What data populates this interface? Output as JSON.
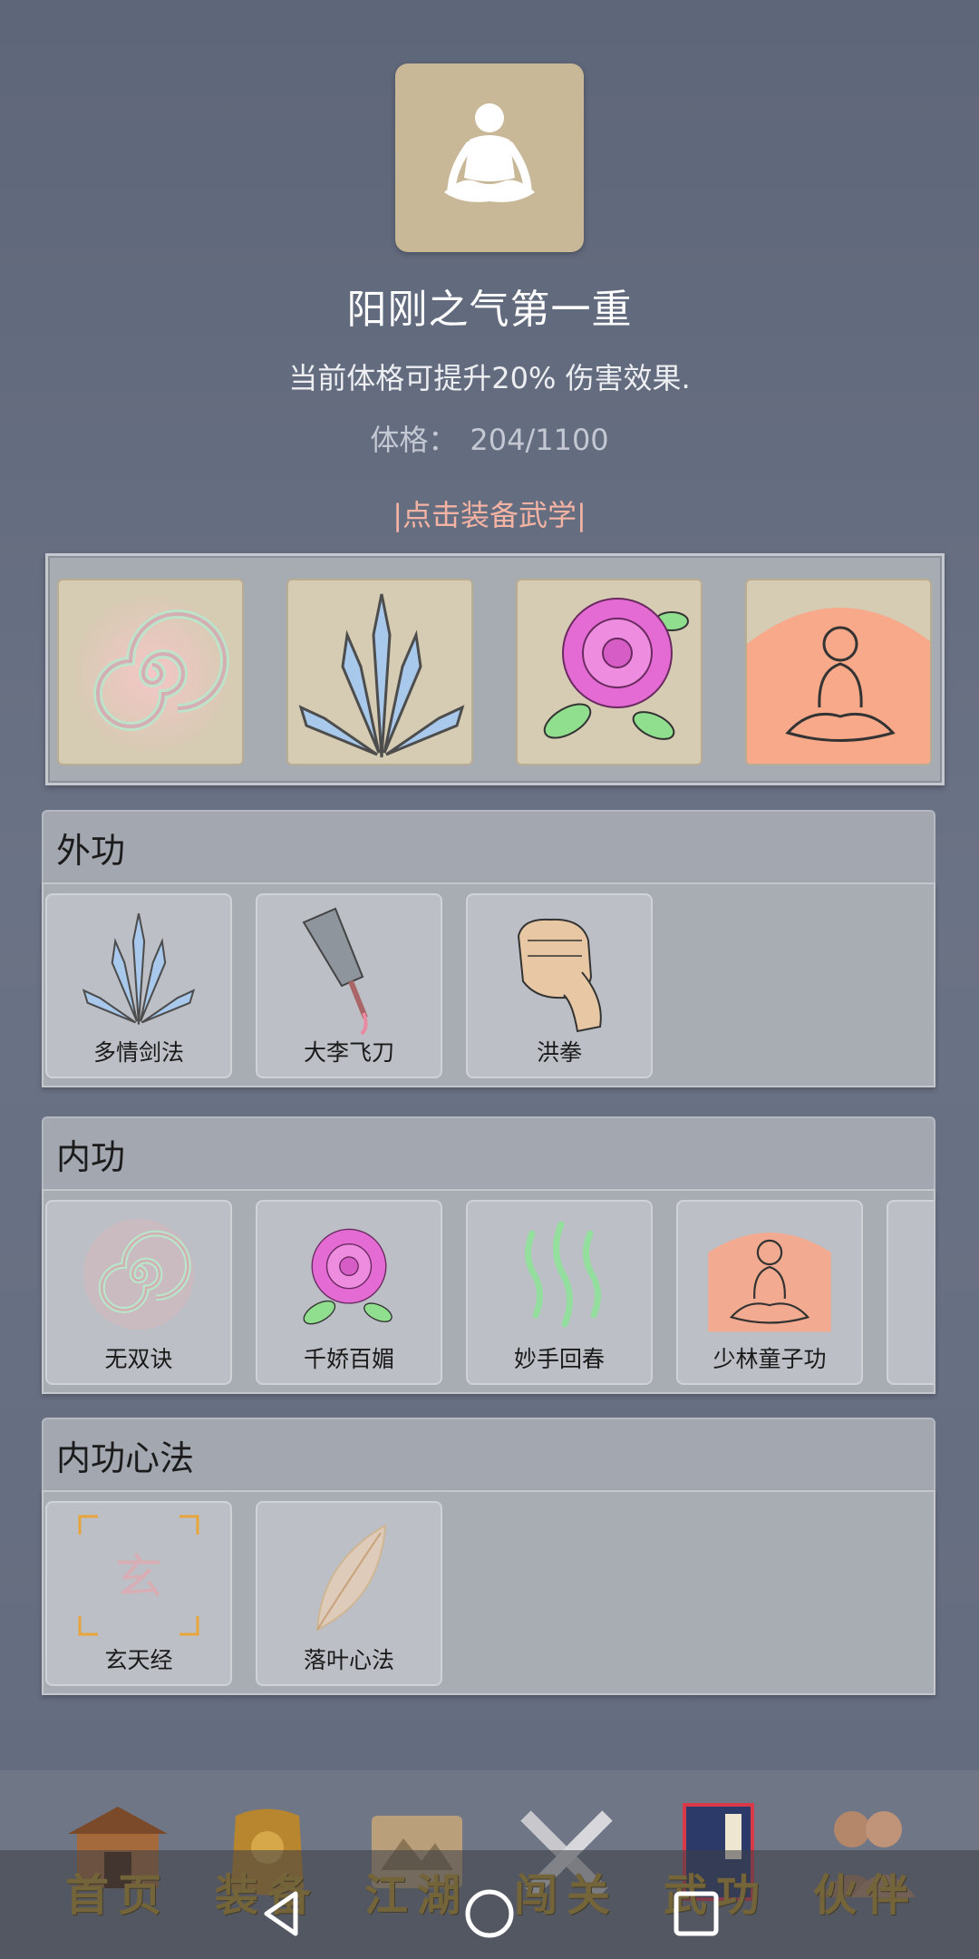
{
  "header": {
    "title": "阳刚之气第一重",
    "description": "当前体格可提升20% 伤害效果.",
    "stat_label": "体格：",
    "stat_value": "204/1100",
    "equip_link": "|点击装备武学|"
  },
  "equipped_slots": [
    {
      "icon": "swirl-icon"
    },
    {
      "icon": "blade-fan-icon"
    },
    {
      "icon": "rose-icon"
    },
    {
      "icon": "meditating-monk-icon"
    }
  ],
  "sections": {
    "outer": {
      "title": "外功",
      "items": [
        {
          "label": "多情剑法",
          "icon": "blade-fan-icon"
        },
        {
          "label": "大李飞刀",
          "icon": "cleaver-icon"
        },
        {
          "label": "洪拳",
          "icon": "fist-icon"
        }
      ]
    },
    "inner": {
      "title": "内功",
      "items": [
        {
          "label": "无双诀",
          "icon": "swirl-icon"
        },
        {
          "label": "千娇百媚",
          "icon": "rose-icon"
        },
        {
          "label": "妙手回春",
          "icon": "green-waves-icon"
        },
        {
          "label": "少林童子功",
          "icon": "meditating-monk-icon"
        }
      ]
    },
    "mind": {
      "title": "内功心法",
      "items": [
        {
          "label": "玄天经",
          "icon": "xuan-seal-icon"
        },
        {
          "label": "落叶心法",
          "icon": "leaf-icon"
        }
      ]
    }
  },
  "bottom_nav": [
    {
      "label": "首页"
    },
    {
      "label": "装备"
    },
    {
      "label": "江湖"
    },
    {
      "label": "闯关"
    },
    {
      "label": "武功"
    },
    {
      "label": "伙伴"
    }
  ],
  "colors": {
    "background": "#656d80",
    "equip_link": "#f5b3a3",
    "nav_text": "#b8922a"
  }
}
